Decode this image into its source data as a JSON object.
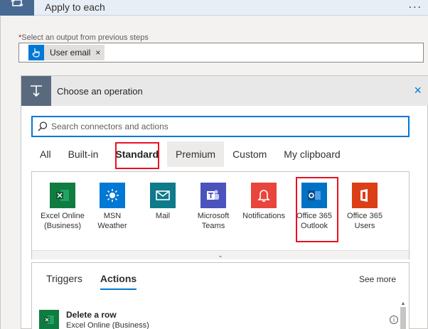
{
  "apply_to_each": {
    "title": "Apply to each",
    "more_label": "..."
  },
  "output_field": {
    "required_star": "*",
    "label": "Select an output from previous steps",
    "token_label": "User email",
    "token_remove": "×"
  },
  "choose_operation": {
    "title": "Choose an operation",
    "close": "×",
    "search_placeholder": "Search connectors and actions",
    "tabs": [
      {
        "label": "All",
        "active": false
      },
      {
        "label": "Built-in",
        "active": false
      },
      {
        "label": "Standard",
        "active": true
      },
      {
        "label": "Premium",
        "active": false
      },
      {
        "label": "Custom",
        "active": false
      },
      {
        "label": "My clipboard",
        "active": false
      }
    ],
    "connectors": [
      {
        "line1": "Excel Online",
        "line2": "(Business)",
        "color": "#107c41",
        "icon": "excel-icon"
      },
      {
        "line1": "MSN",
        "line2": "Weather",
        "color": "#0078d4",
        "icon": "weather-icon"
      },
      {
        "line1": "Mail",
        "line2": "",
        "color": "#0e7a8a",
        "icon": "mail-icon"
      },
      {
        "line1": "Microsoft",
        "line2": "Teams",
        "color": "#4b53bc",
        "icon": "teams-icon"
      },
      {
        "line1": "Notifications",
        "line2": "",
        "color": "#e8453c",
        "icon": "bell-icon"
      },
      {
        "line1": "Office 365",
        "line2": "Outlook",
        "color": "#0072c6",
        "icon": "outlook-icon"
      },
      {
        "line1": "Office 365",
        "line2": "Users",
        "color": "#dc3e15",
        "icon": "office-icon"
      }
    ],
    "expand_glyph": "⌄",
    "sub_tabs": [
      {
        "label": "Triggers",
        "active": false
      },
      {
        "label": "Actions",
        "active": true
      }
    ],
    "see_more": "See more",
    "actions": [
      {
        "title": "Delete a row",
        "subtitle": "Excel Online (Business)",
        "info": "i"
      }
    ]
  },
  "colors": {
    "accent": "#0078d4",
    "highlight": "#e81123"
  }
}
